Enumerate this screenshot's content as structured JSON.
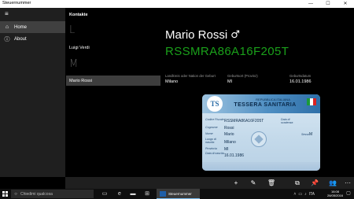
{
  "window": {
    "title": "Steuernummer",
    "minimize_glyph": "—",
    "maximize_glyph": "☐",
    "close_glyph": "✕"
  },
  "nav": {
    "items": [
      {
        "label": "Home",
        "icon": "home-icon",
        "glyph": "⌂",
        "active": true
      },
      {
        "label": "About",
        "icon": "info-icon",
        "glyph": "ⓘ",
        "active": false
      }
    ]
  },
  "header": {
    "title": "Kontakte"
  },
  "contacts": {
    "groups": [
      {
        "letter": "L",
        "items": [
          "Luigi Verdi"
        ]
      },
      {
        "letter": "M",
        "items": [
          "Mario Rossi"
        ]
      }
    ],
    "selected": "Mario Rossi"
  },
  "detail": {
    "name": "Mario Rossi",
    "gender_symbol": "♂",
    "fiscal_code": "RSSMRA86A16F205T",
    "fields": [
      {
        "label": "Landkreis oder Nation der Geburt",
        "value": "Milano"
      },
      {
        "label": "Geburtsort (Provinz)",
        "value": "MI"
      },
      {
        "label": "Geburtsdatum",
        "value": "16.01.1986"
      }
    ]
  },
  "card": {
    "logo_text": "TS",
    "republic": "REPUBBLICA ITALIANA",
    "title": "TESSERA SANITARIA",
    "code_label": "Codice Fiscale",
    "code": "RSSMRA86A16F205T",
    "expiry_label": "Data di scadenza",
    "surname_label": "Cognome",
    "surname": "Rossi",
    "name_label": "Nome",
    "name": "Mario",
    "sex_label": "Sesso",
    "sex": "M",
    "birthplace_label": "Luogo di nascita",
    "birthplace": "Milano",
    "province_label": "Provincia",
    "province": "MI",
    "birthdate_label": "Data di nascita",
    "birthdate": "16.01.1986"
  },
  "commands": [
    {
      "name": "add-icon",
      "glyph": "+"
    },
    {
      "name": "edit-icon",
      "glyph": "✎"
    },
    {
      "name": "delete-icon",
      "glyph": "🗑"
    },
    {
      "name": "copy-icon",
      "glyph": "⧉"
    },
    {
      "name": "pin-icon",
      "glyph": "📌"
    },
    {
      "name": "contacts-icon",
      "glyph": "👥"
    },
    {
      "name": "more-icon",
      "glyph": "···"
    }
  ],
  "taskbar": {
    "search_placeholder": "Chiedimi qualcosa",
    "app_label": "Steuernummer",
    "tray_lang": "ITA",
    "time": "16:08",
    "date": "26/05/2016"
  }
}
